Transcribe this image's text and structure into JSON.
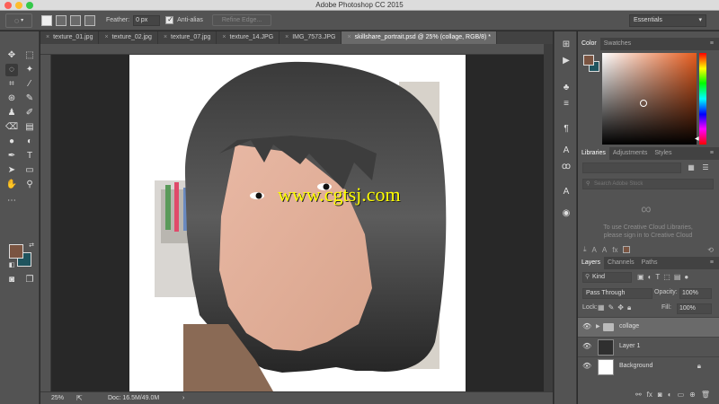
{
  "window": {
    "title": "Adobe Photoshop CC 2015"
  },
  "options_bar": {
    "feather_label": "Feather:",
    "feather_value": "0 px",
    "antialias_label": "Anti-alias",
    "antialias_checked": true,
    "refine_edge_label": "Refine Edge...",
    "workspace": "Essentials"
  },
  "tabs": [
    {
      "label": "texture_01.jpg",
      "active": false
    },
    {
      "label": "texture_02.jpg",
      "active": false
    },
    {
      "label": "texture_07.jpg",
      "active": false
    },
    {
      "label": "texture_14.JPG",
      "active": false
    },
    {
      "label": "IMG_7573.JPG",
      "active": false
    },
    {
      "label": "skillshare_portrait.psd @ 25% (collage, RGB/8) *",
      "active": true
    }
  ],
  "canvas": {
    "watermark": "www.cgtsj.com"
  },
  "status": {
    "zoom": "25%",
    "doc_info": "Doc: 16.5M/49.0M"
  },
  "colors": {
    "foreground": "#7a5441",
    "background": "#1f545e"
  },
  "color_panel": {
    "tabs": [
      "Color",
      "Swatches"
    ],
    "active": "Color"
  },
  "libraries_panel": {
    "tabs": [
      "Libraries",
      "Adjustments",
      "Styles"
    ],
    "active": "Libraries",
    "search_placeholder": "Search Adobe Stock",
    "message_line1": "To use Creative Cloud Libraries,",
    "message_line2": "please sign in to Creative Cloud"
  },
  "layers_panel": {
    "tabs": [
      "Layers",
      "Channels",
      "Paths"
    ],
    "active": "Layers",
    "kind_label": "Kind",
    "blend_mode": "Pass Through",
    "opacity_label": "Opacity:",
    "opacity_value": "100%",
    "lock_label": "Lock:",
    "fill_label": "Fill:",
    "fill_value": "100%",
    "layers": [
      {
        "name": "collage",
        "type": "group",
        "selected": true
      },
      {
        "name": "Layer 1",
        "type": "layer",
        "selected": false
      },
      {
        "name": "Background",
        "type": "background",
        "selected": false,
        "locked": true
      }
    ]
  }
}
